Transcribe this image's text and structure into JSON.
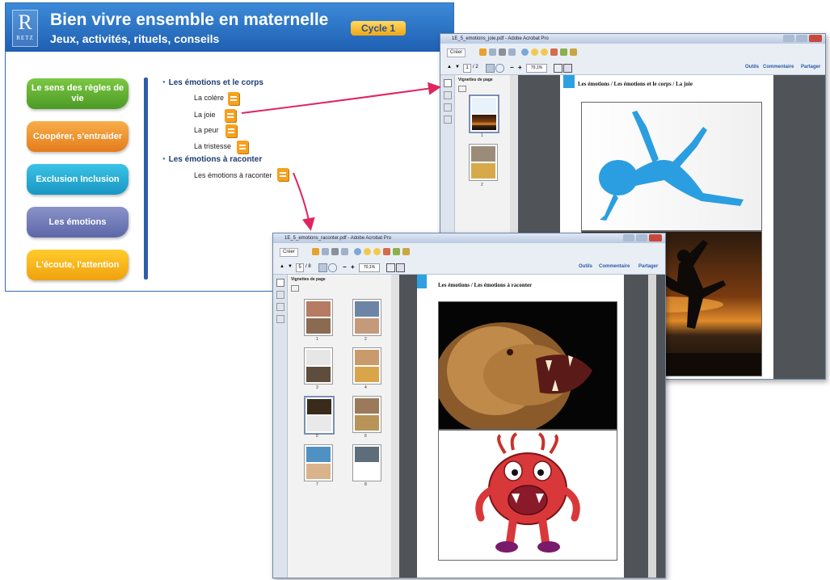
{
  "app": {
    "logo_letter": "R",
    "logo_text": "RETZ",
    "title": "Bien vivre ensemble en maternelle",
    "subtitle": "Jeux, activités, rituels, conseils",
    "badge": "Cycle 1",
    "nav": [
      {
        "label": "Le sens des règles de vie"
      },
      {
        "label": "Coopérer, s'entraider"
      },
      {
        "label": "Exclusion Inclusion"
      },
      {
        "label": "Les émotions"
      },
      {
        "label": "L'écoute, l'attention"
      }
    ],
    "sections": [
      {
        "title": "Les émotions et le corps",
        "items": [
          "La colère",
          "La joie",
          "La peur",
          "La tristesse"
        ]
      },
      {
        "title": "Les émotions à raconter",
        "items": [
          "Les émotions à raconter"
        ]
      }
    ]
  },
  "viewer_joy": {
    "title": "1E_5_emotions_joie.pdf - Adobe Acrobat Pro",
    "create_label": "Créer",
    "page_field": "1",
    "page_total": "/ 2",
    "zoom": "70,1%",
    "right_tools": [
      "Outils",
      "Commentaire",
      "Partager"
    ],
    "panel_title": "Vignettes de page",
    "heading": "Les émotions / Les émotions et le corps / La joie",
    "thumb_numbers": [
      "1",
      "2"
    ]
  },
  "viewer_tell": {
    "title": "1E_5_emotions_raconter.pdf - Adobe Acrobat Pro",
    "create_label": "Créer",
    "page_field": "5",
    "page_total": "/ 8",
    "zoom": "70,1%",
    "right_tools": [
      "Outils",
      "Commentaire",
      "Partager"
    ],
    "panel_title": "Vignettes de page",
    "heading": "Les émotions / Les émotions à raconter",
    "thumb_numbers": [
      "1",
      "2",
      "3",
      "4",
      "5",
      "6",
      "7",
      "8"
    ]
  },
  "colors": {
    "header_blue": "#1f5fb2",
    "arrow": "#e0245e",
    "acrobat_blue": "#2da1e0"
  }
}
